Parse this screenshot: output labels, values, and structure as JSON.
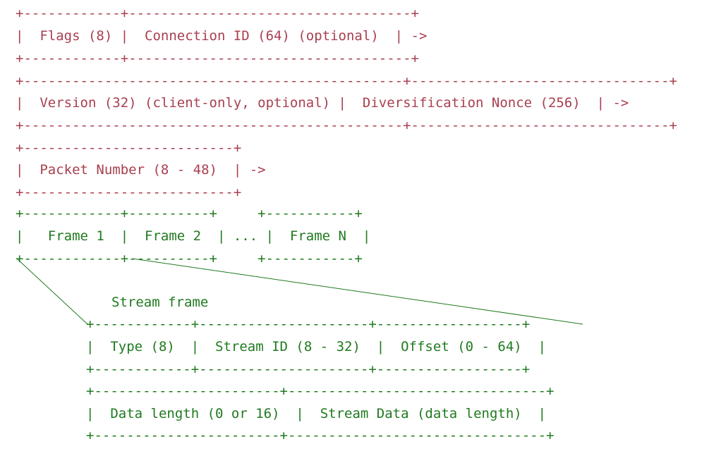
{
  "colors": {
    "header": "#a83f4f",
    "payload": "#1f7a1f",
    "background": "#ffffff"
  },
  "header_rows": [
    {
      "top": "+------------+-----------------------------------+",
      "middle": "|  Flags (8) |  Connection ID (64) (optional)  | ->",
      "bottom": "+------------+-----------------------------------+"
    },
    {
      "top": "+-----------------------------------------------+--------------------------------+",
      "middle": "|  Version (32) (client-only, optional) |  Diversification Nonce (256)  | ->",
      "bottom": "+-----------------------------------------------+--------------------------------+"
    },
    {
      "top": "+--------------------------+",
      "middle": "|  Packet Number (8 - 48)  | ->",
      "bottom": "+--------------------------+"
    }
  ],
  "frames_row": {
    "top": "+------------+----------+     +-----------+",
    "middle": "|   Frame 1  |  Frame 2  | ... |  Frame N  |",
    "bottom": "+------------+----------+     +-----------+"
  },
  "stream_frame": {
    "title": "Stream frame",
    "row1_top": "+------------+---------------------+------------------+",
    "row1_middle": "|  Type (8)  |  Stream ID (8 - 32)  |  Offset (0 - 64)  |",
    "row1_bottom": "+------------+---------------------+------------------+",
    "row2_top": "+-----------------------+--------------------------------+",
    "row2_middle": "|  Data length (0 or 16)  |  Stream Data (data length)  |",
    "row2_bottom": "+-----------------------+--------------------------------+"
  }
}
